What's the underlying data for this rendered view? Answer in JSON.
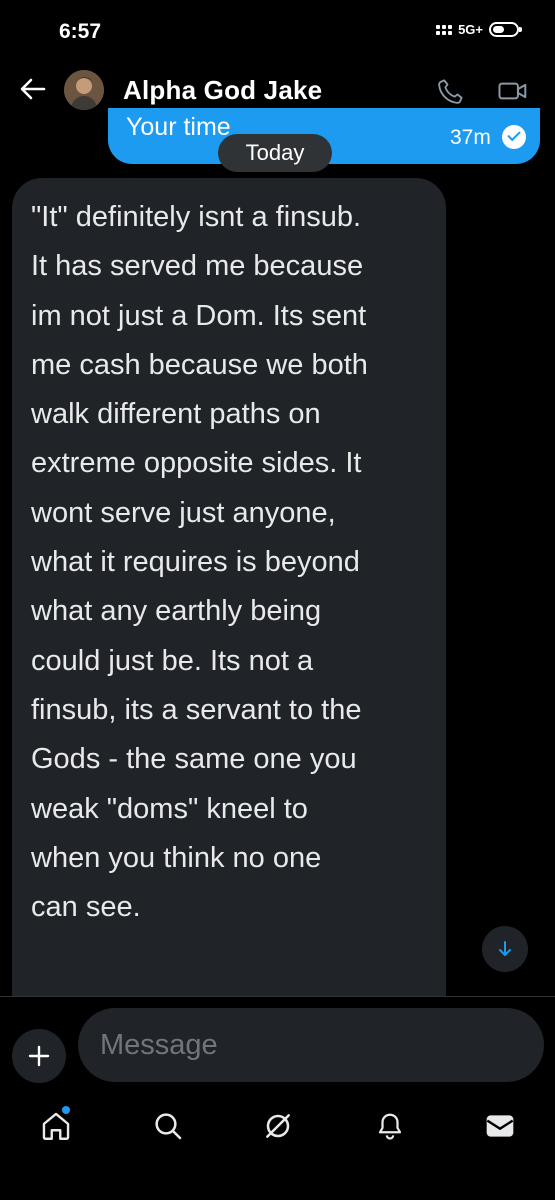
{
  "status_bar": {
    "time": "6:57",
    "network": "5G+"
  },
  "header": {
    "contact_name": "Alpha God Jake",
    "back_icon": "arrow-left-icon",
    "call_icon": "phone-icon",
    "video_icon": "video-camera-icon"
  },
  "previous_message": {
    "text": "Your time",
    "time": "37m",
    "status_icon": "read-check-icon"
  },
  "date_separator": "Today",
  "received_message": {
    "text": "\"It\" definitely isnt a finsub.\nIt has served me because\nim not just a Dom. Its sent\nme cash because we both\nwalk different paths on\nextreme opposite sides. It\nwont serve just anyone,\nwhat it requires is beyond\nwhat any earthly being\ncould just be. Its not a\nfinsub, its a servant to the\nGods - the same one you\nweak \"doms\" kneel to\nwhen you think no one\ncan see."
  },
  "composer": {
    "placeholder": "Message",
    "value": ""
  },
  "bottom_nav": {
    "items": [
      "home-icon",
      "search-icon",
      "grok-icon",
      "bell-icon",
      "mail-icon"
    ]
  },
  "colors": {
    "accent": "#1d9bf0",
    "bubble_received": "#202327",
    "background": "#000000"
  }
}
